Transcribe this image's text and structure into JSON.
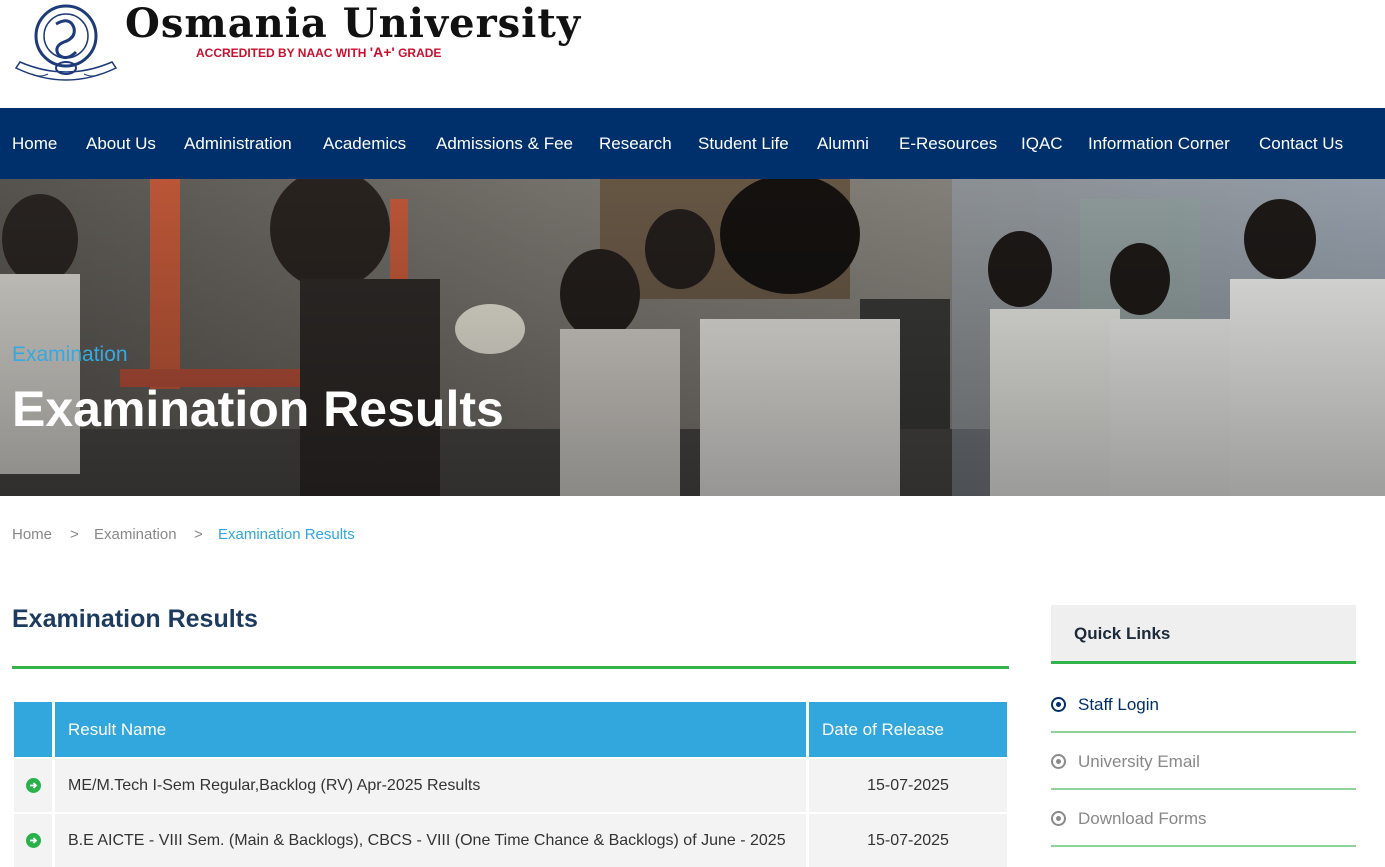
{
  "brand": {
    "title": "Osmania University",
    "tagline_pre": "ACCREDITED BY NAAC WITH ",
    "tagline_grade": "'A+'",
    "tagline_post": " GRADE"
  },
  "nav": {
    "items": [
      "Home",
      "About Us",
      "Administration",
      "Academics",
      "Admissions & Fee",
      "Research",
      "Student Life",
      "Alumni",
      "E-Resources",
      "IQAC",
      "Information Corner",
      "Contact Us"
    ]
  },
  "hero": {
    "kicker": "Examination",
    "title": "Examination Results"
  },
  "breadcrumb": {
    "home": "Home",
    "sep1": ">",
    "section": "Examination",
    "sep2": ">",
    "current": "Examination Results"
  },
  "main": {
    "heading": "Examination Results",
    "table": {
      "columns": [
        "",
        "Result Name",
        "Date of Release"
      ],
      "rows": [
        {
          "name": "ME/M.Tech I-Sem Regular,Backlog (RV) Apr-2025 Results",
          "date": "15-07-2025"
        },
        {
          "name": "B.E AICTE - VIII Sem. (Main & Backlogs), CBCS - VIII (One Time Chance & Backlogs) of June - 2025",
          "date": "15-07-2025"
        }
      ]
    }
  },
  "quick_links": {
    "title": "Quick Links",
    "items": [
      "Staff Login",
      "University Email",
      "Download Forms"
    ]
  },
  "colors": {
    "nav_bg": "#00306b",
    "accent_blue": "#31a7dd",
    "accent_green": "#33b34a",
    "heading_navy": "#1d3a5f"
  }
}
